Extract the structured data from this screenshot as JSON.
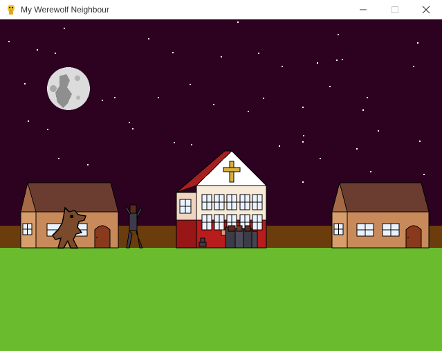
{
  "window": {
    "title": "My Werewolf Neighbour",
    "app_icon": "pygame-snake-icon",
    "controls": [
      "minimize-icon",
      "maximize-icon",
      "close-icon"
    ]
  },
  "scene": {
    "colors": {
      "sky": "#2c0220",
      "ground": "#6abb2e",
      "fence": "#6b3c0c",
      "moon": "#dcdcdc",
      "house_wall": "#c88a5a",
      "house_roof": "#6b3d30",
      "church_wall": "#f8ead8",
      "church_lower": "#b81c1c",
      "church_roof": "#a52020",
      "cross": "#d8b040",
      "werewolf": "#7a4a2a",
      "zombie": "#3c3c48"
    },
    "sprites": [
      "moon",
      "left-house",
      "werewolf",
      "zombie",
      "church",
      "zombie-group",
      "right-house"
    ]
  }
}
